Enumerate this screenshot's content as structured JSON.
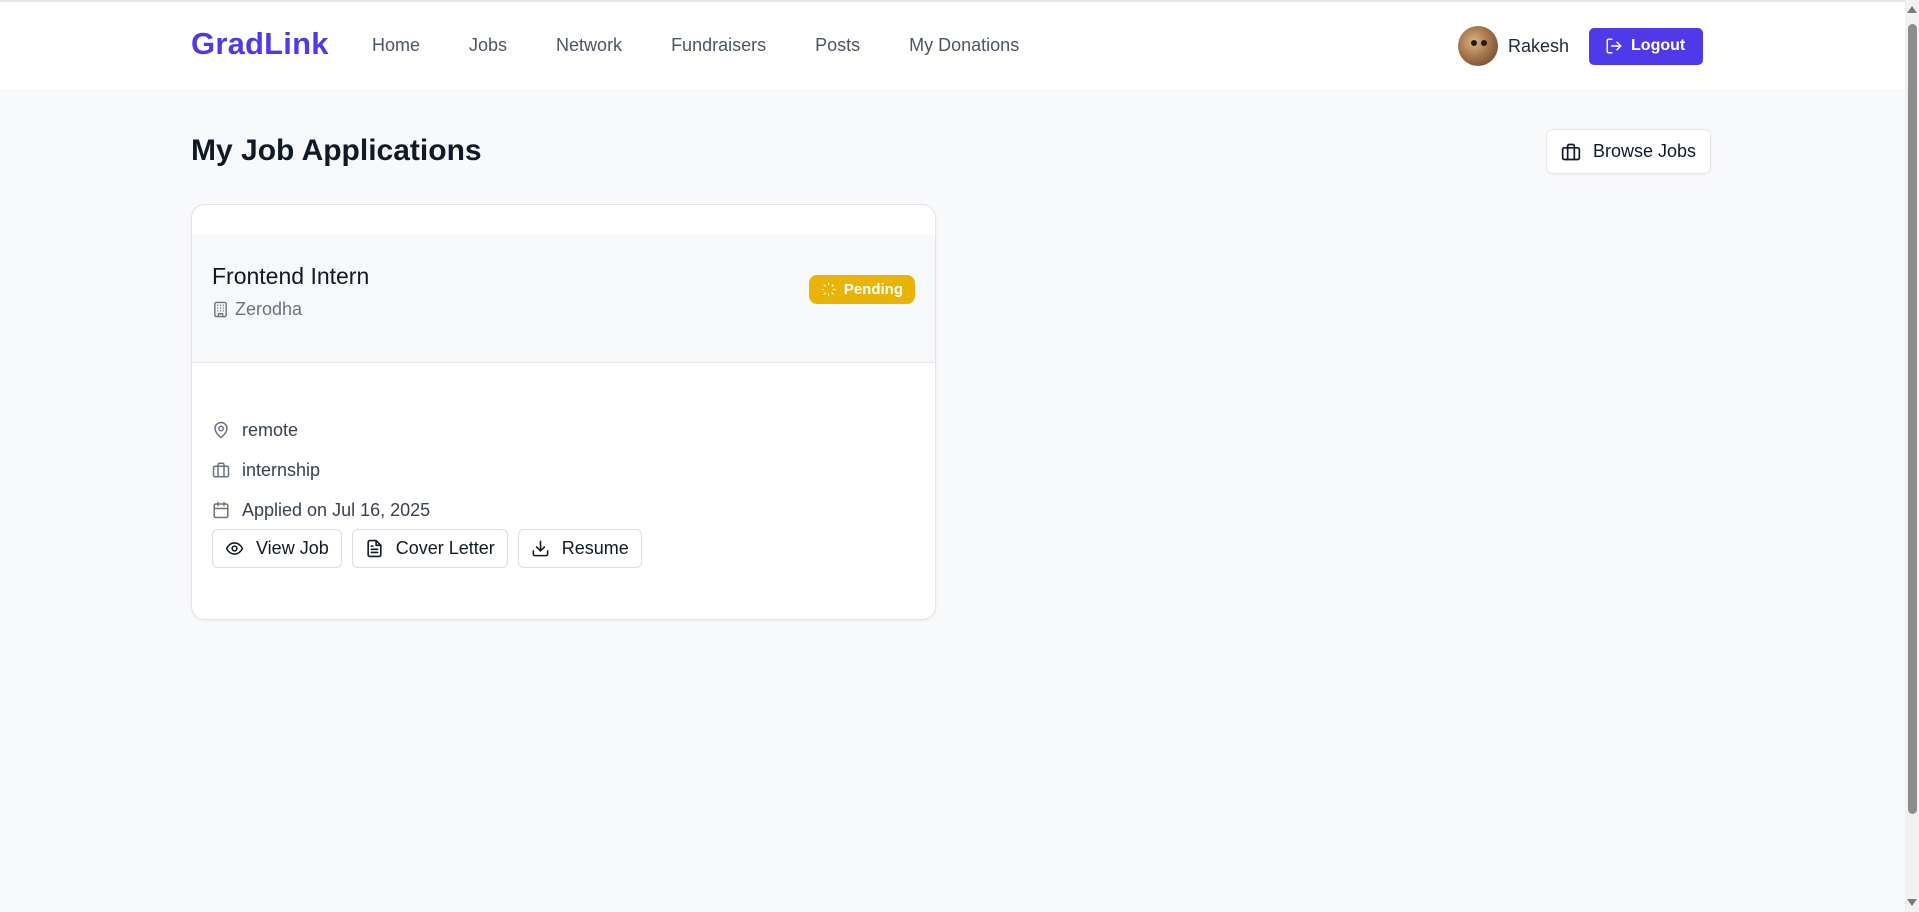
{
  "app": {
    "brand": "GradLink"
  },
  "nav": {
    "links": [
      "Home",
      "Jobs",
      "Network",
      "Fundraisers",
      "Posts",
      "My Donations"
    ]
  },
  "user": {
    "name": "Rakesh",
    "logout_label": "Logout"
  },
  "page": {
    "title": "My Job Applications",
    "browse_label": "Browse Jobs"
  },
  "applications": [
    {
      "title": "Frontend Intern",
      "company": "Zerodha",
      "status": "Pending",
      "location": "remote",
      "type": "internship",
      "applied": "Applied on Jul 16, 2025",
      "actions": {
        "view": "View Job",
        "cover": "Cover Letter",
        "resume": "Resume"
      }
    }
  ],
  "colors": {
    "accent": "#4f39e8",
    "pending": "#eab308"
  }
}
